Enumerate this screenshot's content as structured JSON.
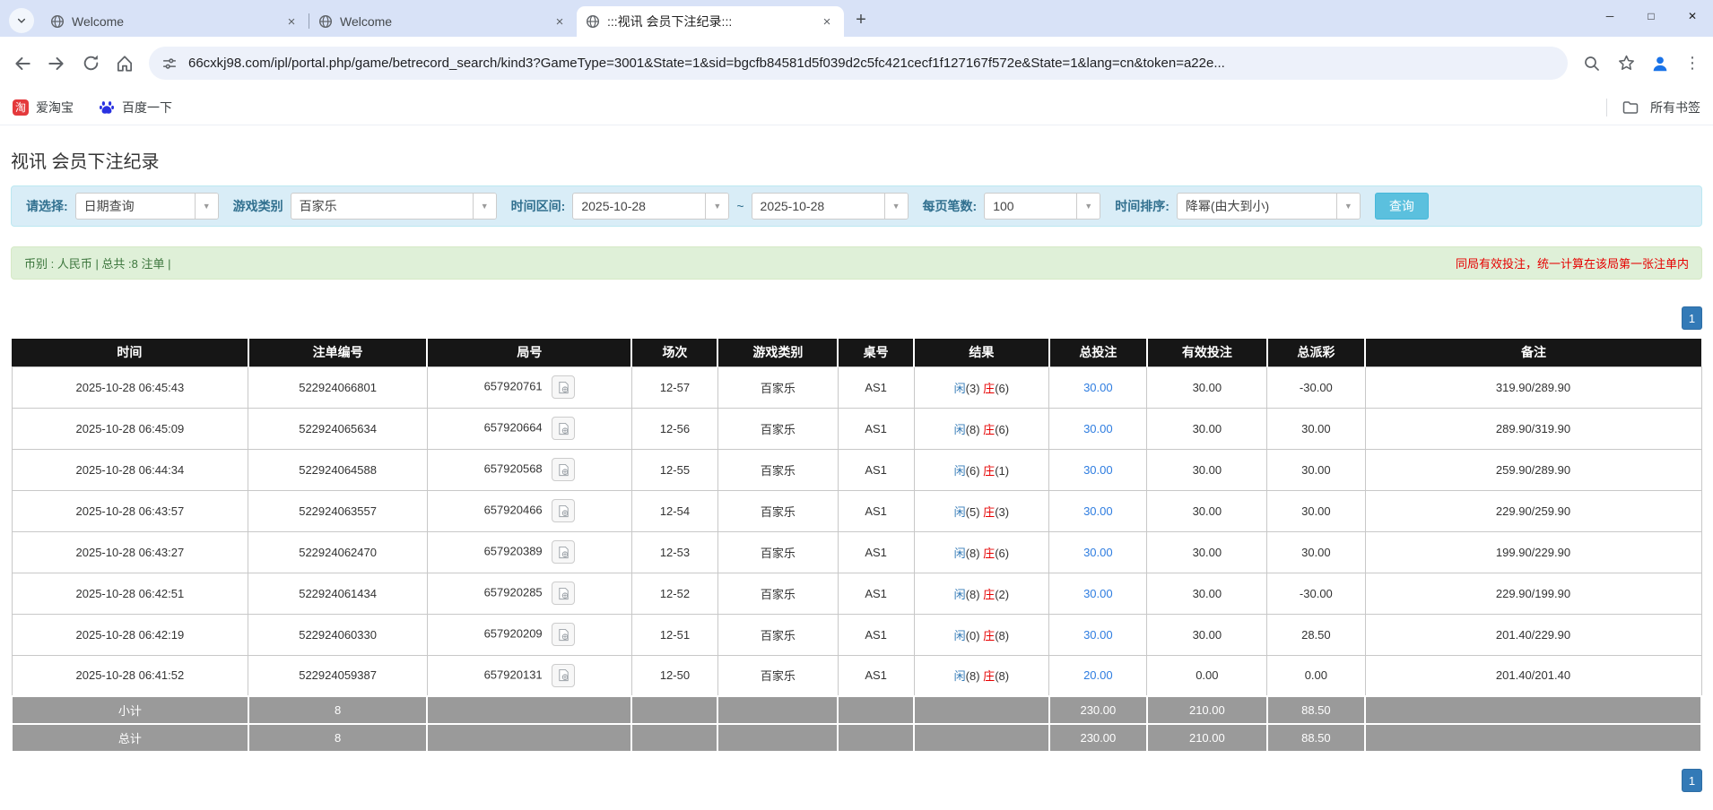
{
  "browser": {
    "tabs": [
      {
        "title": "Welcome"
      },
      {
        "title": "Welcome"
      },
      {
        "title": ":::视讯 会员下注纪录:::"
      }
    ],
    "glyphs": {
      "close_tab": "×",
      "new_tab": "+"
    },
    "window": {
      "minimize": "─",
      "maximize": "□",
      "close": "✕"
    },
    "url": "66cxkj98.com/ipl/portal.php/game/betrecord_search/kind3?GameType=3001&State=1&sid=bgcfb84581d5f039d2c5fc421cecf1f127167f572e&State=1&lang=cn&token=a22e...",
    "bookmarks": [
      {
        "label": "爱淘宝"
      },
      {
        "label": "百度一下"
      }
    ],
    "all_bookmarks_label": "所有书签"
  },
  "page": {
    "title": "视讯 会员下注纪录",
    "filters": {
      "select_label": "请选择:",
      "select_value": "日期查询",
      "game_type_label": "游戏类别",
      "game_type_value": "百家乐",
      "date_range_label": "时间区间:",
      "date_from": "2025-10-28",
      "date_separator": "~",
      "date_to": "2025-10-28",
      "page_size_label": "每页笔数:",
      "page_size_value": "100",
      "sort_label": "时间排序:",
      "sort_value": "降幂(由大到小)",
      "search_button": "查询"
    },
    "summary": {
      "left": "币别 : 人民币 | 总共 :8 注单 |",
      "right_notice": "同局有效投注，统一计算在该局第一张注单内"
    },
    "pagination": {
      "page": "1"
    }
  },
  "table": {
    "headers": [
      "时间",
      "注单编号",
      "局号",
      "场次",
      "游戏类别",
      "桌号",
      "结果",
      "总投注",
      "有效投注",
      "总派彩",
      "备注"
    ],
    "rows": [
      {
        "time": "2025-10-28 06:45:43",
        "bet_id": "522924066801",
        "round": "657920761",
        "session": "12-57",
        "game": "百家乐",
        "table_no": "AS1",
        "result": {
          "player": "闲",
          "player_n": "(3)",
          "banker": "庄",
          "banker_n": "(6)"
        },
        "total_bet": "30.00",
        "valid_bet": "30.00",
        "payout": "-30.00",
        "remark": "319.90/289.90"
      },
      {
        "time": "2025-10-28 06:45:09",
        "bet_id": "522924065634",
        "round": "657920664",
        "session": "12-56",
        "game": "百家乐",
        "table_no": "AS1",
        "result": {
          "player": "闲",
          "player_n": "(8)",
          "banker": "庄",
          "banker_n": "(6)"
        },
        "total_bet": "30.00",
        "valid_bet": "30.00",
        "payout": "30.00",
        "remark": "289.90/319.90"
      },
      {
        "time": "2025-10-28 06:44:34",
        "bet_id": "522924064588",
        "round": "657920568",
        "session": "12-55",
        "game": "百家乐",
        "table_no": "AS1",
        "result": {
          "player": "闲",
          "player_n": "(6)",
          "banker": "庄",
          "banker_n": "(1)"
        },
        "total_bet": "30.00",
        "valid_bet": "30.00",
        "payout": "30.00",
        "remark": "259.90/289.90"
      },
      {
        "time": "2025-10-28 06:43:57",
        "bet_id": "522924063557",
        "round": "657920466",
        "session": "12-54",
        "game": "百家乐",
        "table_no": "AS1",
        "result": {
          "player": "闲",
          "player_n": "(5)",
          "banker": "庄",
          "banker_n": "(3)"
        },
        "total_bet": "30.00",
        "valid_bet": "30.00",
        "payout": "30.00",
        "remark": "229.90/259.90"
      },
      {
        "time": "2025-10-28 06:43:27",
        "bet_id": "522924062470",
        "round": "657920389",
        "session": "12-53",
        "game": "百家乐",
        "table_no": "AS1",
        "result": {
          "player": "闲",
          "player_n": "(8)",
          "banker": "庄",
          "banker_n": "(6)"
        },
        "total_bet": "30.00",
        "valid_bet": "30.00",
        "payout": "30.00",
        "remark": "199.90/229.90"
      },
      {
        "time": "2025-10-28 06:42:51",
        "bet_id": "522924061434",
        "round": "657920285",
        "session": "12-52",
        "game": "百家乐",
        "table_no": "AS1",
        "result": {
          "player": "闲",
          "player_n": "(8)",
          "banker": "庄",
          "banker_n": "(2)"
        },
        "total_bet": "30.00",
        "valid_bet": "30.00",
        "payout": "-30.00",
        "remark": "229.90/199.90"
      },
      {
        "time": "2025-10-28 06:42:19",
        "bet_id": "522924060330",
        "round": "657920209",
        "session": "12-51",
        "game": "百家乐",
        "table_no": "AS1",
        "result": {
          "player": "闲",
          "player_n": "(0)",
          "banker": "庄",
          "banker_n": "(8)"
        },
        "total_bet": "30.00",
        "valid_bet": "30.00",
        "payout": "28.50",
        "remark": "201.40/229.90"
      },
      {
        "time": "2025-10-28 06:41:52",
        "bet_id": "522924059387",
        "round": "657920131",
        "session": "12-50",
        "game": "百家乐",
        "table_no": "AS1",
        "result": {
          "player": "闲",
          "player_n": "(8)",
          "banker": "庄",
          "banker_n": "(8)"
        },
        "total_bet": "20.00",
        "valid_bet": "0.00",
        "payout": "0.00",
        "remark": "201.40/201.40"
      }
    ],
    "footer_rows": [
      {
        "label": "小计",
        "count": "8",
        "total_bet": "230.00",
        "valid_bet": "210.00",
        "payout": "88.50"
      },
      {
        "label": "总计",
        "count": "8",
        "total_bet": "230.00",
        "valid_bet": "210.00",
        "payout": "88.50"
      }
    ]
  },
  "colors": {
    "accent_blue": "#337ab7",
    "amount_blue": "#2d7ce0",
    "danger_red": "#e60000",
    "filter_bg": "#d9edf7",
    "summary_bg": "#dff0d8",
    "header_bg": "#161616",
    "footer_gray": "#9a9a9a",
    "query_btn": "#5bc0de"
  }
}
